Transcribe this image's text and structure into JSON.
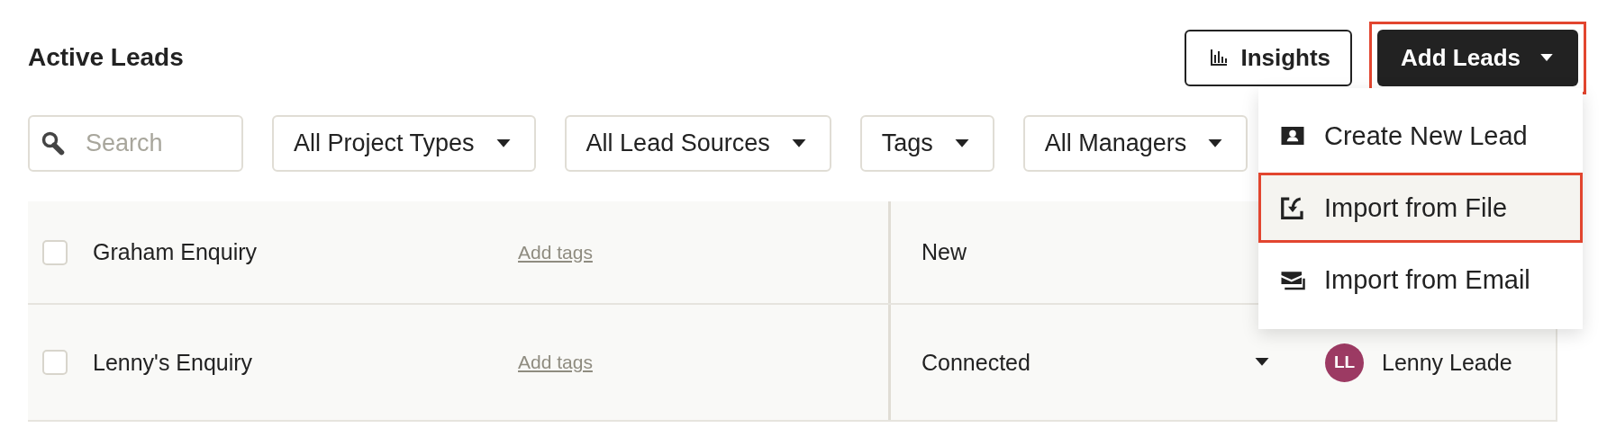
{
  "header": {
    "title": "Active Leads",
    "insights_button": {
      "label": "Insights"
    },
    "add_button": {
      "label": "Add Leads",
      "annotated": true
    }
  },
  "filters": {
    "search": {
      "placeholder": "Search"
    },
    "dropdowns": [
      {
        "label": "All Project Types"
      },
      {
        "label": "All Lead Sources"
      },
      {
        "label": "Tags"
      },
      {
        "label": "All Managers"
      }
    ]
  },
  "rows": [
    {
      "name": "Graham Enquiry",
      "checked": false,
      "tags_link": "Add tags",
      "status": "New"
    },
    {
      "name": "Lenny's Enquiry",
      "checked": false,
      "tags_link": "Add tags",
      "status": "Connected",
      "manager": {
        "initials": "LL",
        "name": "Lenny Leade",
        "color": "#9c3a63"
      }
    }
  ],
  "menu": {
    "items": [
      {
        "kind": "person",
        "label": "Create New Lead",
        "selected": false,
        "annotated": false
      },
      {
        "kind": "file",
        "label": "Import from File",
        "selected": true,
        "annotated": true
      },
      {
        "kind": "email",
        "label": "Import from Email",
        "selected": false,
        "annotated": false
      }
    ]
  }
}
